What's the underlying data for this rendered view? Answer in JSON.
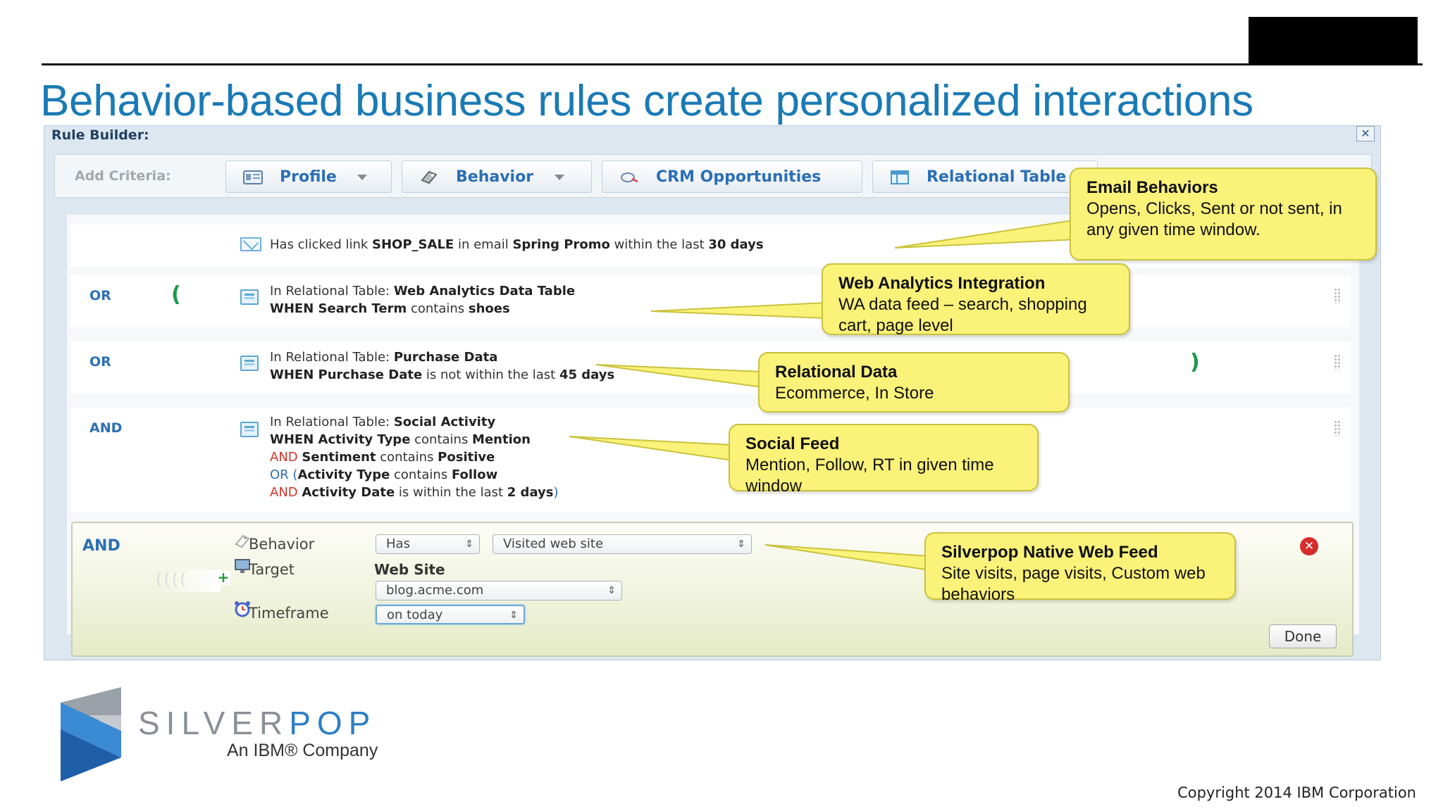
{
  "slide": {
    "title": "Behavior-based business rules create personalized interactions",
    "copyright": "Copyright 2014 IBM Corporation"
  },
  "rule_builder": {
    "title": "Rule Builder:",
    "close_label": "✕",
    "add_criteria_label": "Add Criteria:",
    "criteria_buttons": [
      {
        "label": "Profile",
        "icon": "profile-card-icon",
        "has_dropdown": true
      },
      {
        "label": "Behavior",
        "icon": "behavior-tag-icon",
        "has_dropdown": true
      },
      {
        "label": "CRM Opportunities",
        "icon": "crm-icon",
        "has_dropdown": false
      },
      {
        "label": "Relational Table",
        "icon": "relational-table-icon",
        "has_dropdown": false
      }
    ],
    "rules": [
      {
        "operator": "",
        "icon": "email-icon",
        "line1": {
          "p1": "Has clicked link ",
          "b1": "SHOP_SALE",
          "p2": " in email ",
          "b2": "Spring Promo",
          "p3": " within the last ",
          "b3": "30 days"
        }
      },
      {
        "operator": "OR",
        "open_paren": "(",
        "icon": "relational-table-icon",
        "line1": {
          "p1": "In Relational Table: ",
          "b1": "Web Analytics Data Table"
        },
        "line2": {
          "k": "WHEN ",
          "b1": "Search Term",
          "p1": " contains ",
          "b2": "shoes"
        }
      },
      {
        "operator": "OR",
        "close_paren": ")",
        "icon": "relational-table-icon",
        "line1": {
          "p1": "In Relational Table: ",
          "b1": "Purchase Data"
        },
        "line2": {
          "k": "WHEN ",
          "b1": "Purchase Date",
          "p1": " is not within the last ",
          "b2": "45 days"
        }
      },
      {
        "operator": "AND",
        "icon": "relational-table-icon",
        "line1": {
          "p1": "In Relational Table: ",
          "b1": "Social Activity"
        },
        "line2": {
          "k": "WHEN ",
          "b1": "Activity Type",
          "p1": " contains ",
          "b2": "Mention"
        },
        "line3": {
          "k": "AND ",
          "b1": "Sentiment",
          "p1": " contains ",
          "b2": "Positive"
        },
        "line4": {
          "k": "OR ",
          "p0": "(",
          "b1": "Activity Type",
          "p1": " contains ",
          "b2": "Follow"
        },
        "line5": {
          "k": "AND ",
          "b1": "Activity Date",
          "p1": " is within the last ",
          "b2": "2 days",
          "p2": ")"
        }
      }
    ],
    "edit_rule": {
      "operator": "AND",
      "behavior_label": "Behavior",
      "behavior_select_1": "Has",
      "behavior_select_2": "Visited web site",
      "target_label": "Target",
      "target_value": "Web Site",
      "target_select": "blog.acme.com",
      "timeframe_label": "Timeframe",
      "timeframe_select": "on today",
      "add_icon_label": "+",
      "remove_icon_label": "✕",
      "done_label": "Done"
    }
  },
  "callouts": [
    {
      "title": "Email Behaviors",
      "body": "Opens, Clicks, Sent or not sent, in any given time window."
    },
    {
      "title": "Web Analytics Integration",
      "body": "WA data feed – search, shopping cart, page level"
    },
    {
      "title": "Relational Data",
      "body": "Ecommerce, In Store"
    },
    {
      "title": "Social Feed",
      "body": "Mention, Follow, RT in given time window"
    },
    {
      "title": "Silverpop Native Web Feed",
      "body": "Site visits, page visits, Custom web behaviors"
    }
  ],
  "logo": {
    "brand_silver": "SILVER",
    "brand_pop": "POP",
    "tagline": "An IBM® Company"
  },
  "colors": {
    "title_blue": "#1a7ab5",
    "link_blue": "#2b6fb5",
    "callout_yellow": "#fbf27a",
    "and_red": "#d2332b",
    "paren_green": "#1a9a4a"
  }
}
